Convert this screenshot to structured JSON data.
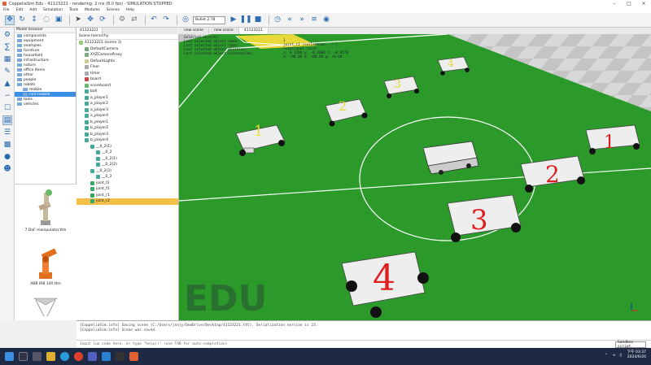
{
  "window": {
    "title": "CoppeliaSim Edu - 41123221 - rendering: 2 ms (8.0 fps) - SIMULATION STOPPED"
  },
  "menu": [
    "File",
    "Edit",
    "Add",
    "Simulation",
    "Tools",
    "Modules",
    "Scenes",
    "Help"
  ],
  "toolbar": {
    "engine": "Bullet 2.78"
  },
  "model_browser": {
    "header": "Model browser",
    "items": [
      {
        "label": "components",
        "indent": 0,
        "selected": false
      },
      {
        "label": "equipment",
        "indent": 0,
        "selected": false
      },
      {
        "label": "examples",
        "indent": 0,
        "selected": false
      },
      {
        "label": "furniture",
        "indent": 0,
        "selected": false
      },
      {
        "label": "household",
        "indent": 0,
        "selected": false
      },
      {
        "label": "infrastructure",
        "indent": 0,
        "selected": false
      },
      {
        "label": "nature",
        "indent": 0,
        "selected": false
      },
      {
        "label": "office items",
        "indent": 0,
        "selected": false
      },
      {
        "label": "other",
        "indent": 0,
        "selected": false
      },
      {
        "label": "people",
        "indent": 0,
        "selected": false
      },
      {
        "label": "robots",
        "indent": 0,
        "selected": false
      },
      {
        "label": "mobile",
        "indent": 1,
        "selected": false
      },
      {
        "label": "non-mobile",
        "indent": 1,
        "selected": true
      },
      {
        "label": "tools",
        "indent": 0,
        "selected": false
      },
      {
        "label": "vehicles",
        "indent": 0,
        "selected": false
      }
    ],
    "thumbnails": [
      {
        "label": "7 DoF manipulator.ttm"
      },
      {
        "label": "ABB IRB 140.ttm"
      }
    ]
  },
  "scene_tabs": [
    "41123221"
  ],
  "scene_hierarchy": {
    "header": "Scene hierarchy",
    "items": [
      {
        "label": "41123221 (scene 3)",
        "indent": 0,
        "color": "#9c7",
        "selected": false
      },
      {
        "label": "DefaultCamera",
        "indent": 1,
        "color": "#7a7",
        "selected": false
      },
      {
        "label": "XYZCameraProxy",
        "indent": 1,
        "color": "#7a7",
        "selected": false
      },
      {
        "label": "DefaultLights",
        "indent": 1,
        "color": "#cc8",
        "selected": false
      },
      {
        "label": "Floor",
        "indent": 1,
        "color": "#aaa",
        "selected": false
      },
      {
        "label": "timer",
        "indent": 1,
        "color": "#aaa",
        "selected": false
      },
      {
        "label": "board",
        "indent": 1,
        "color": "#c44",
        "selected": false
      },
      {
        "label": "scoreboard",
        "indent": 1,
        "color": "#6b6",
        "selected": false
      },
      {
        "label": "ball",
        "indent": 1,
        "color": "#4a9",
        "selected": false
      },
      {
        "label": "a_player1",
        "indent": 1,
        "color": "#4a9",
        "selected": false
      },
      {
        "label": "a_player2",
        "indent": 1,
        "color": "#4a9",
        "selected": false
      },
      {
        "label": "a_player3",
        "indent": 1,
        "color": "#4a9",
        "selected": false
      },
      {
        "label": "a_player4",
        "indent": 1,
        "color": "#4a9",
        "selected": false
      },
      {
        "label": "b_player1",
        "indent": 1,
        "color": "#4a9",
        "selected": false
      },
      {
        "label": "b_player2",
        "indent": 1,
        "color": "#4a9",
        "selected": false
      },
      {
        "label": "b_player3",
        "indent": 1,
        "color": "#4a9",
        "selected": false
      },
      {
        "label": "b_player4",
        "indent": 1,
        "color": "#4a9",
        "selected": false
      },
      {
        "label": "__0_2(1)",
        "indent": 2,
        "color": "#4a9",
        "selected": false
      },
      {
        "label": "__0_2",
        "indent": 3,
        "color": "#4a9",
        "selected": false
      },
      {
        "label": "__0_2(1)",
        "indent": 3,
        "color": "#4a9",
        "selected": false
      },
      {
        "label": "__0_2(2)",
        "indent": 3,
        "color": "#4a9",
        "selected": false
      },
      {
        "label": "__0_2(3)",
        "indent": 2,
        "color": "#4a9",
        "selected": false
      },
      {
        "label": "__0_2",
        "indent": 3,
        "color": "#4a9",
        "selected": false
      },
      {
        "label": "joint_f2",
        "indent": 2,
        "color": "#3a6",
        "selected": false
      },
      {
        "label": "joint_f1",
        "indent": 2,
        "color": "#3a6",
        "selected": false
      },
      {
        "label": "joint_r1",
        "indent": 2,
        "color": "#3a6",
        "selected": false
      },
      {
        "label": "joint_r2",
        "indent": 2,
        "color": "#3a6",
        "selected": true
      }
    ]
  },
  "view_tabs": [
    "new scene",
    "new scene",
    "41123221"
  ],
  "viewport": {
    "info_left": [
      "Selected objects:",
      "Last selected object name:",
      "Last selected object type:",
      "Last selected object position:",
      "Last selected object orientation:"
    ],
    "info_right": [
      "1",
      "joint_r2 (collection: ---)",
      "rotational joint",
      "x: 0.3200  y: -0.2000  z: +0.0578",
      "a: -90.00  b: +00.00  g: +0.00"
    ],
    "watermark": "EDU",
    "player_numbers": [
      "1",
      "2",
      "3",
      "4",
      "1",
      "2",
      "3",
      "4"
    ]
  },
  "console": {
    "lines": [
      "[CoppeliaSim:info] Saving scene (C:/Users/jsnjy/OneDrive/Desktop/41123221.ttt). Serialization version is 23.",
      "[CoppeliaSim:info] Scene was saved."
    ]
  },
  "command": {
    "placeholder": "Input lua code here, or type \"help()\" (use TAB for auto-completion)",
    "sandbox": "Sandbox script"
  },
  "taskbar": {
    "time": "下午 03:37",
    "date": "2024/6/20"
  }
}
